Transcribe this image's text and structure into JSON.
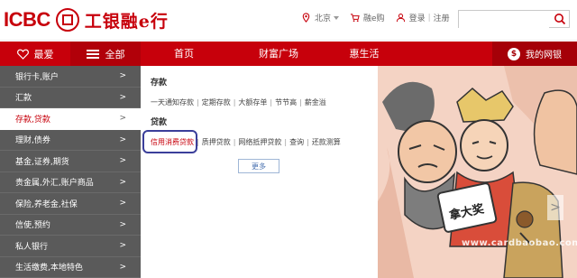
{
  "header": {
    "logo_text": "ICBC",
    "logo_cn": "工银融e行",
    "location": "北京",
    "cart": "融e购",
    "login": "登录",
    "separator": "|",
    "register": "注册",
    "search_placeholder": ""
  },
  "nav": {
    "favorites": "最爱",
    "all": "全部",
    "items": [
      "首页",
      "财富广场",
      "惠生活"
    ],
    "mybank": "我的网银",
    "bag_glyph": "$"
  },
  "sidebar": {
    "arrow": ">",
    "items": [
      {
        "label": "银行卡,账户"
      },
      {
        "label": "汇款"
      },
      {
        "label": "存款,贷款"
      },
      {
        "label": "理财,债券"
      },
      {
        "label": "基金,证券,期货"
      },
      {
        "label": "贵金属,外汇,账户商品"
      },
      {
        "label": "保险,养老金,社保"
      },
      {
        "label": "信使,预约"
      },
      {
        "label": "私人银行"
      },
      {
        "label": "生活缴费,本地特色"
      }
    ]
  },
  "panel": {
    "deposit_title": "存款",
    "deposit_links": [
      "一天通知存款",
      "定期存款",
      "大额存单",
      "节节高",
      "薪金溢"
    ],
    "loan_title": "贷款",
    "loan_links": [
      "信用消费贷款",
      "质押贷款",
      "网络抵押贷款",
      "查询",
      "还款测算"
    ],
    "more": "更多"
  },
  "banner": {
    "sign_text": "拿大奖",
    "watermark": "www.cardbaobao.com",
    "next_arrow": ">"
  },
  "colors": {
    "brand_red": "#c7000b",
    "sidebar_gray": "#5a5a5a",
    "highlight": "#3b3f9a"
  }
}
